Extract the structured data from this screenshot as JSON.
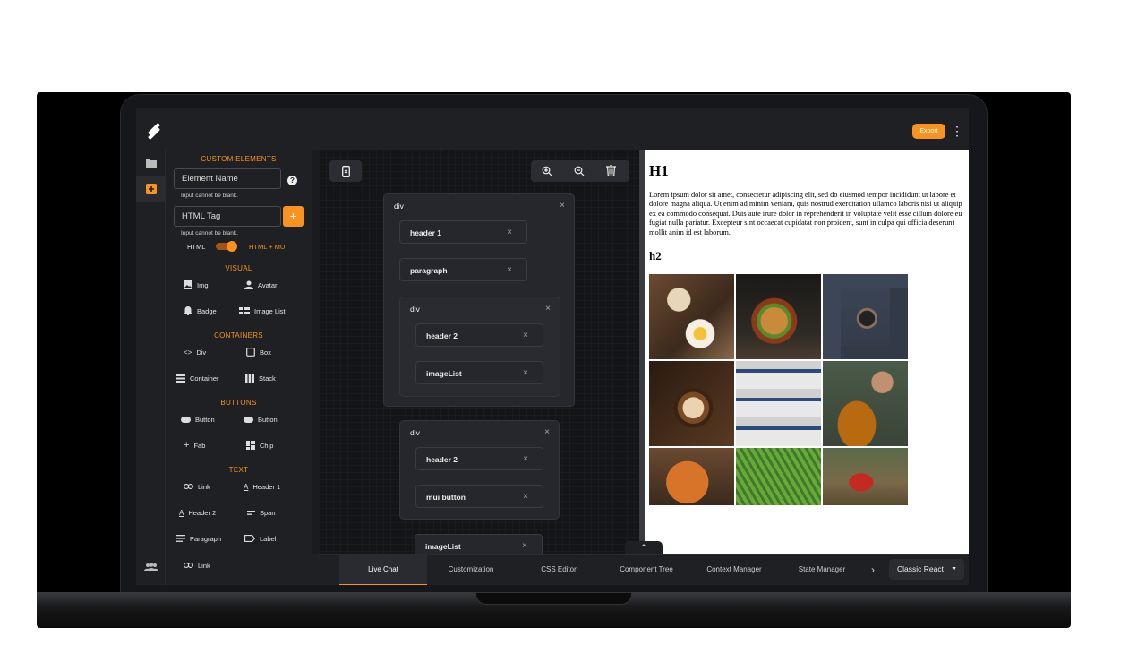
{
  "header": {
    "export_label": "Export",
    "menu_icon": "more-vert-icon"
  },
  "rail": {
    "items": [
      "folder-icon",
      "add-box-icon",
      "people-icon"
    ]
  },
  "custom": {
    "section": "CUSTOM ELEMENTS",
    "element_name_placeholder": "Element Name",
    "element_hint": "Input cannot be blank.",
    "html_tag_placeholder": "HTML Tag",
    "tag_hint": "Input cannot be blank.",
    "add_label": "+",
    "help_label": "?",
    "toggle_left": "HTML",
    "toggle_right": "HTML + MUI"
  },
  "visual": {
    "section": "VISUAL",
    "items": [
      "Img",
      "Avatar",
      "Badge",
      "Image List"
    ]
  },
  "containers": {
    "section": "CONTAINERS",
    "items": [
      "Div",
      "Box",
      "Container",
      "Stack"
    ]
  },
  "buttons": {
    "section": "BUTTONS",
    "items": [
      "Button",
      "Button",
      "Fab",
      "Chip"
    ]
  },
  "text": {
    "section": "TEXT",
    "items": [
      "Link",
      "Header 1",
      "Header 2",
      "Span",
      "Paragraph",
      "Label",
      "Link"
    ]
  },
  "tree": {
    "div1": "div",
    "div1_children": [
      "header 1",
      "paragraph"
    ],
    "div1_nested": "div",
    "div1_nested_children": [
      "header 2",
      "imageList"
    ],
    "div2": "div",
    "div2_children": [
      "header 2",
      "mui button"
    ],
    "last": "imageList",
    "close": "×"
  },
  "preview": {
    "h1": "H1",
    "paragraph": "Lorem ipsum dolor sit amet, consectetur adipiscing elit, sed do eiusmod tempor incididunt ut labore et dolore magna aliqua. Ut enim ad minim veniam, quis nostrud exercitation ullamco laboris nisi ut aliquip ex ea commodo consequat. Duis aute irure dolor in reprehenderit in voluptate velit esse cillum dolore eu fugiat nulla pariatur. Excepteur sint occaecat cupidatat non proident, sunt in culpa qui officia deserunt mollit anim id est laborum.",
    "h2": "h2",
    "photos": [
      "breakfast",
      "burger",
      "camera",
      "coffee",
      "hats",
      "honey",
      "basketball",
      "fern",
      "mushroom"
    ]
  },
  "bottom": {
    "tabs": [
      "Live Chat",
      "Customization",
      "CSS Editor",
      "Component Tree",
      "Context Manager",
      "State Manager"
    ],
    "more": "›",
    "framework": "Classic React"
  },
  "colors": {
    "accent": "#f7931e",
    "bg": "#1f2023",
    "canvas": "#141518"
  }
}
